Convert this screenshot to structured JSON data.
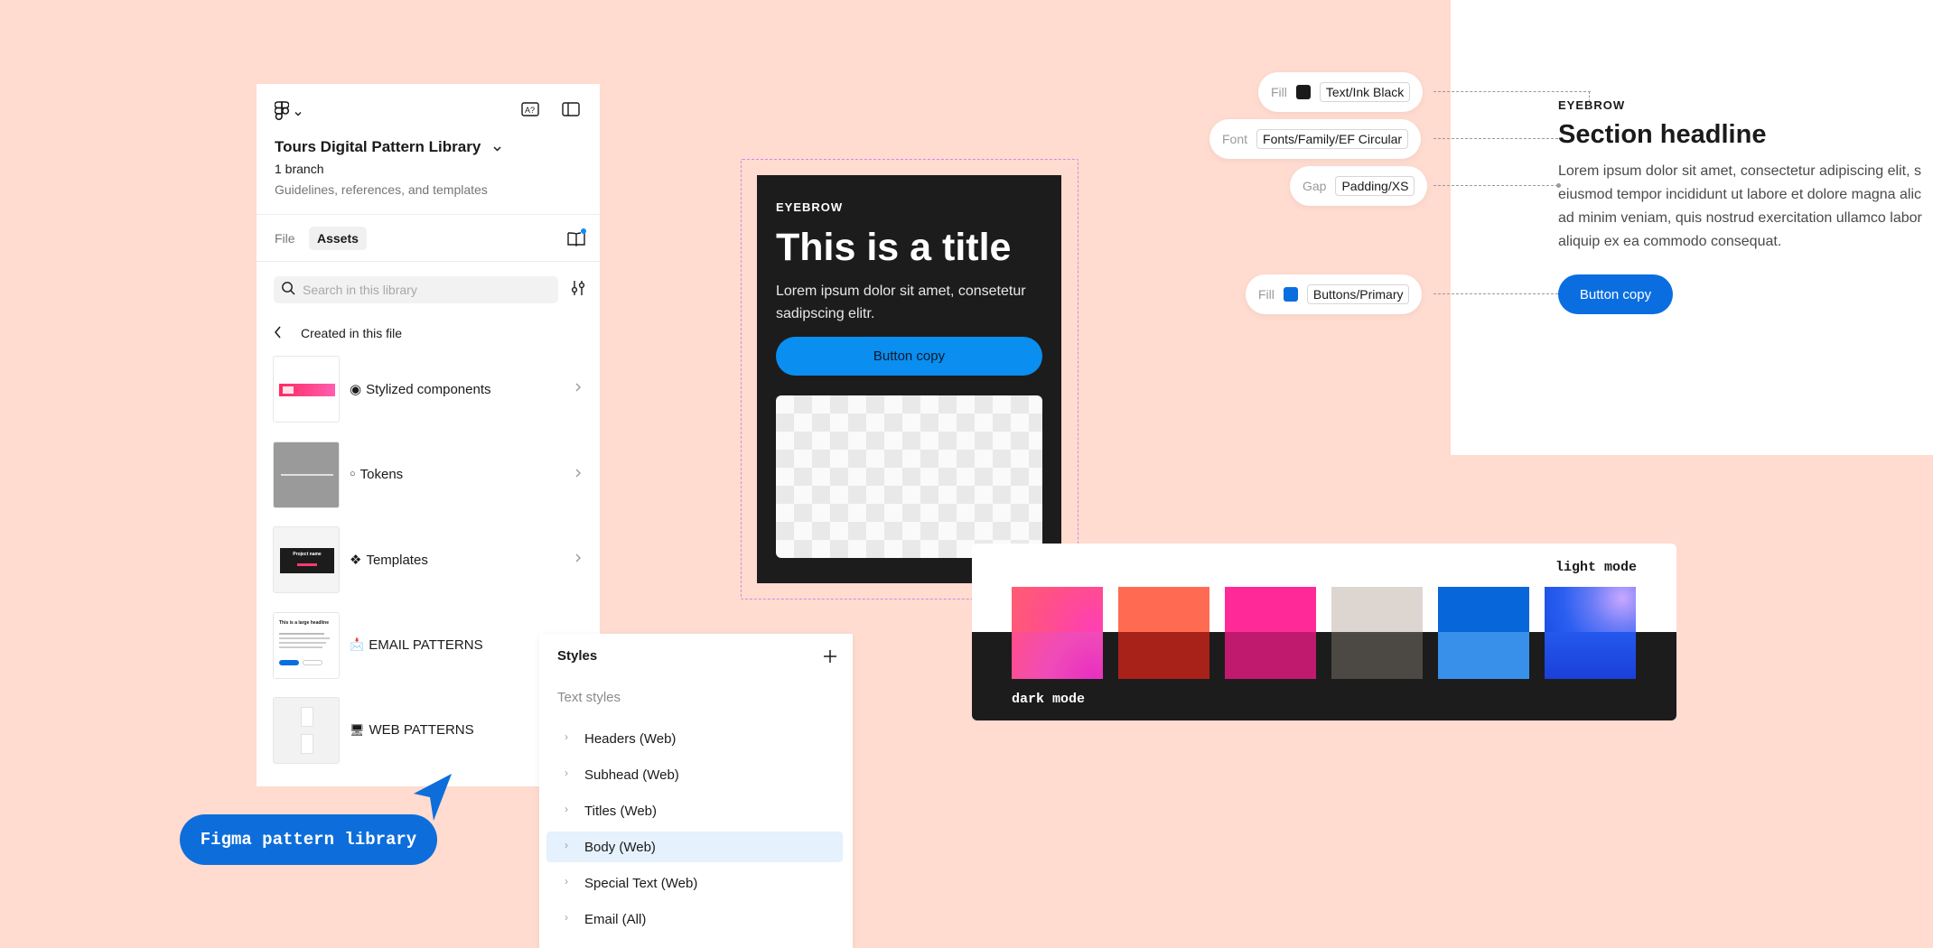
{
  "panel": {
    "library_title": "Tours Digital Pattern Library",
    "branch": "1 branch",
    "description": "Guidelines, references, and templates",
    "tabs": [
      {
        "label": "File"
      },
      {
        "label": "Assets"
      }
    ],
    "search_placeholder": "Search in this library",
    "back_label": "Created in this file",
    "assets": [
      {
        "emoji": "◉",
        "label": "Stylized components"
      },
      {
        "emoji": "○",
        "label": "Tokens"
      },
      {
        "emoji": "❖",
        "label": "Templates"
      },
      {
        "emoji": "📩",
        "label": "EMAIL PATTERNS"
      },
      {
        "emoji": "🖥",
        "label": "WEB PATTERNS"
      }
    ],
    "thumb_email_headline": "This is a large headline",
    "thumb_template_text": "Project name"
  },
  "callout": {
    "label": "Figma pattern library"
  },
  "styles_panel": {
    "title": "Styles",
    "add_icon": "plus-icon",
    "section": "Text styles",
    "items": [
      {
        "label": "Headers (Web)"
      },
      {
        "label": "Subhead (Web)"
      },
      {
        "label": "Titles (Web)"
      },
      {
        "label": "Body (Web)"
      },
      {
        "label": "Special Text (Web)"
      },
      {
        "label": "Email (All)"
      }
    ]
  },
  "dark_card": {
    "eyebrow": "EYEBROW",
    "title": "This is a title",
    "body": "Lorem ipsum dolor sit amet, consetetur sadipscing elitr.",
    "button": "Button copy"
  },
  "spec": {
    "tags": [
      {
        "key": "Fill",
        "value": "Text/Ink Black",
        "swatch": "#1a1a1a"
      },
      {
        "key": "Font",
        "value": "Fonts/Family/EF Circular"
      },
      {
        "key": "Gap",
        "value": "Padding/XS"
      },
      {
        "key": "Fill",
        "value": "Buttons/Primary",
        "swatch": "#0a6ee0"
      }
    ],
    "eyebrow": "EYEBROW",
    "headline": "Section headline",
    "body_lines": [
      "Lorem ipsum dolor sit amet, consectetur adipiscing elit, s",
      "eiusmod tempor incididunt ut labore et dolore magna alic",
      "ad minim veniam, quis nostrud exercitation ullamco labor",
      "aliquip ex ea commodo consequat."
    ],
    "button": "Button copy"
  },
  "palette": {
    "light_label": "light mode",
    "dark_label": "dark mode",
    "swatches": [
      {
        "name": "pink-gradient",
        "light": "#ff4f8a",
        "dark": "#f04cb8"
      },
      {
        "name": "coral",
        "light": "#ff6b52",
        "dark": "#a8221a"
      },
      {
        "name": "magenta",
        "light": "#ff2a97",
        "dark": "#c01a6e"
      },
      {
        "name": "stone",
        "light": "#ddd6d0",
        "dark": "#4c4843"
      },
      {
        "name": "blue",
        "light": "#0766d9",
        "dark": "#3890ea"
      },
      {
        "name": "blue-gradient",
        "light": "#2a5ff0",
        "dark": "#1a40d8"
      }
    ]
  },
  "colors": {
    "background": "#ffdbd0",
    "accent_blue": "#0d6edb",
    "dark_surface": "#1c1c1c"
  }
}
